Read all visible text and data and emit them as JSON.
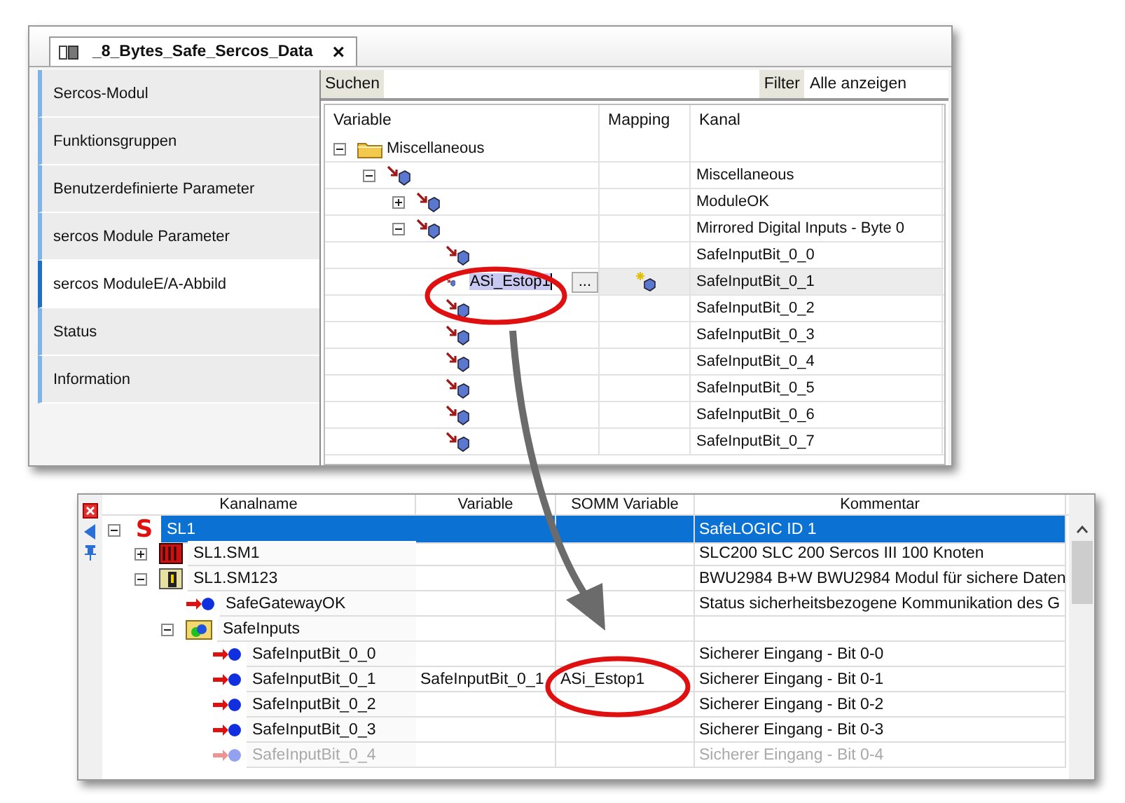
{
  "editor": {
    "tab": {
      "title": "_8_Bytes_Safe_Sercos_Data",
      "close": "×"
    },
    "nav": [
      {
        "label": "Sercos-Modul",
        "selected": false
      },
      {
        "label": "Funktionsgruppen",
        "selected": false
      },
      {
        "label": "Benutzerdefinierte Parameter",
        "selected": false
      },
      {
        "label": "sercos Module Parameter",
        "selected": false
      },
      {
        "label": "sercos ModuleE/A-Abbild",
        "selected": true
      },
      {
        "label": "Status",
        "selected": false
      },
      {
        "label": "Information",
        "selected": false
      }
    ],
    "search": {
      "label": "Suchen"
    },
    "filter": {
      "label": "Filter",
      "value": "Alle anzeigen"
    },
    "table": {
      "columns": [
        "Variable",
        "Mapping",
        "Kanal"
      ],
      "rows": [
        {
          "kind": "folder",
          "label": "Miscellaneous",
          "expanded": true,
          "children": [
            {
              "kind": "channel",
              "kanal": "Miscellaneous",
              "expanded": true,
              "children": [
                {
                  "kind": "channel",
                  "kanal": "ModuleOK",
                  "expanded": false
                },
                {
                  "kind": "channel",
                  "kanal": "Mirrored Digital Inputs - Byte 0",
                  "expanded": true,
                  "children": [
                    {
                      "kind": "channel",
                      "kanal": "SafeInputBit_0_0",
                      "selected": false
                    },
                    {
                      "kind": "channel",
                      "kanal": "SafeInputBit_0_1",
                      "selected": true,
                      "mapped": true,
                      "variable": "ASi_Estop1",
                      "browse": "..."
                    },
                    {
                      "kind": "channel",
                      "kanal": "SafeInputBit_0_2",
                      "selected": false
                    },
                    {
                      "kind": "channel",
                      "kanal": "SafeInputBit_0_3",
                      "selected": false
                    },
                    {
                      "kind": "channel",
                      "kanal": "SafeInputBit_0_4",
                      "selected": false
                    },
                    {
                      "kind": "channel",
                      "kanal": "SafeInputBit_0_5",
                      "selected": false
                    },
                    {
                      "kind": "channel",
                      "kanal": "SafeInputBit_0_6",
                      "selected": false
                    },
                    {
                      "kind": "channel",
                      "kanal": "SafeInputBit_0_7",
                      "selected": false
                    }
                  ]
                }
              ]
            }
          ]
        }
      ]
    }
  },
  "mapping_window": {
    "columns": [
      "Kanalname",
      "Variable",
      "SOMM Variable",
      "Kommentar"
    ],
    "rows": [
      {
        "kind": "safelogic",
        "symbol": "S",
        "name": "SL1",
        "expanded": true,
        "selected": true,
        "comment": "SafeLOGIC ID 1",
        "children": [
          {
            "kind": "module",
            "name": "SL1.SM1",
            "expanded": false,
            "selected": false,
            "comment": "SLC200 SLC 200 Sercos III 100 Knoten"
          },
          {
            "kind": "safemodule",
            "name": "SL1.SM123",
            "expanded": true,
            "selected": false,
            "comment": "BWU2984 B+W BWU2984 Modul für sichere Daten",
            "children": [
              {
                "kind": "channel",
                "name": "SafeGatewayOK",
                "selected": false,
                "comment": "Status sicherheitsbezogene Kommunikation des G"
              },
              {
                "kind": "group",
                "name": "SafeInputs",
                "expanded": true,
                "selected": false,
                "children": [
                  {
                    "kind": "channel",
                    "name": "SafeInputBit_0_0",
                    "selected": false,
                    "comment": "Sicherer Eingang - Bit 0-0"
                  },
                  {
                    "kind": "channel",
                    "name": "SafeInputBit_0_1",
                    "selected": false,
                    "variable": "SafeInputBit_0_1",
                    "somm": "ASi_Estop1",
                    "comment": "Sicherer Eingang - Bit 0-1"
                  },
                  {
                    "kind": "channel",
                    "name": "SafeInputBit_0_2",
                    "selected": false,
                    "comment": "Sicherer Eingang - Bit 0-2"
                  },
                  {
                    "kind": "channel",
                    "name": "SafeInputBit_0_3",
                    "selected": false,
                    "comment": "Sicherer Eingang - Bit 0-3"
                  },
                  {
                    "kind": "channel",
                    "name": "SafeInputBit_0_4",
                    "selected": false,
                    "disabled": true,
                    "comment": "Sicherer Eingang - Bit 0-4"
                  }
                ]
              }
            ]
          }
        ]
      }
    ]
  }
}
